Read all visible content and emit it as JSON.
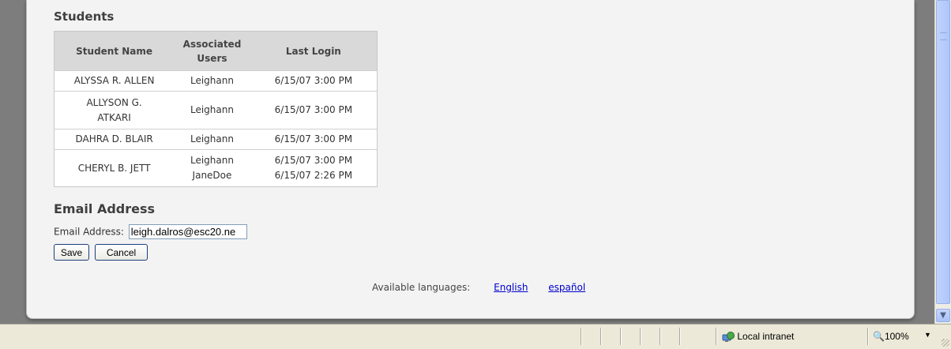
{
  "students": {
    "title": "Students",
    "columns": [
      "Student Name",
      "Associated Users",
      "Last Login"
    ],
    "rows": [
      {
        "name": "ALYSSA R. ALLEN",
        "users": [
          "Leighann"
        ],
        "logins": [
          "6/15/07 3:00 PM"
        ]
      },
      {
        "name": "ALLYSON G. ATKARI",
        "users": [
          "Leighann"
        ],
        "logins": [
          "6/15/07 3:00 PM"
        ]
      },
      {
        "name": "DAHRA D. BLAIR",
        "users": [
          "Leighann"
        ],
        "logins": [
          "6/15/07 3:00 PM"
        ]
      },
      {
        "name": "CHERYL B. JETT",
        "users": [
          "Leighann",
          "JaneDoe"
        ],
        "logins": [
          "6/15/07 3:00 PM",
          "6/15/07 2:26 PM"
        ]
      }
    ]
  },
  "email": {
    "title": "Email Address",
    "label": "Email Address:",
    "value": "leigh.dalros@esc20.ne"
  },
  "buttons": {
    "save": "Save",
    "cancel": "Cancel"
  },
  "languages": {
    "label": "Available languages:",
    "options": [
      "English",
      "español"
    ]
  },
  "statusbar": {
    "zone": "Local intranet",
    "zoom": "100%"
  },
  "icons": [
    "local-intranet-icon",
    "zoom-icon",
    "scroll-down-arrow-icon",
    "resize-grip-icon"
  ]
}
